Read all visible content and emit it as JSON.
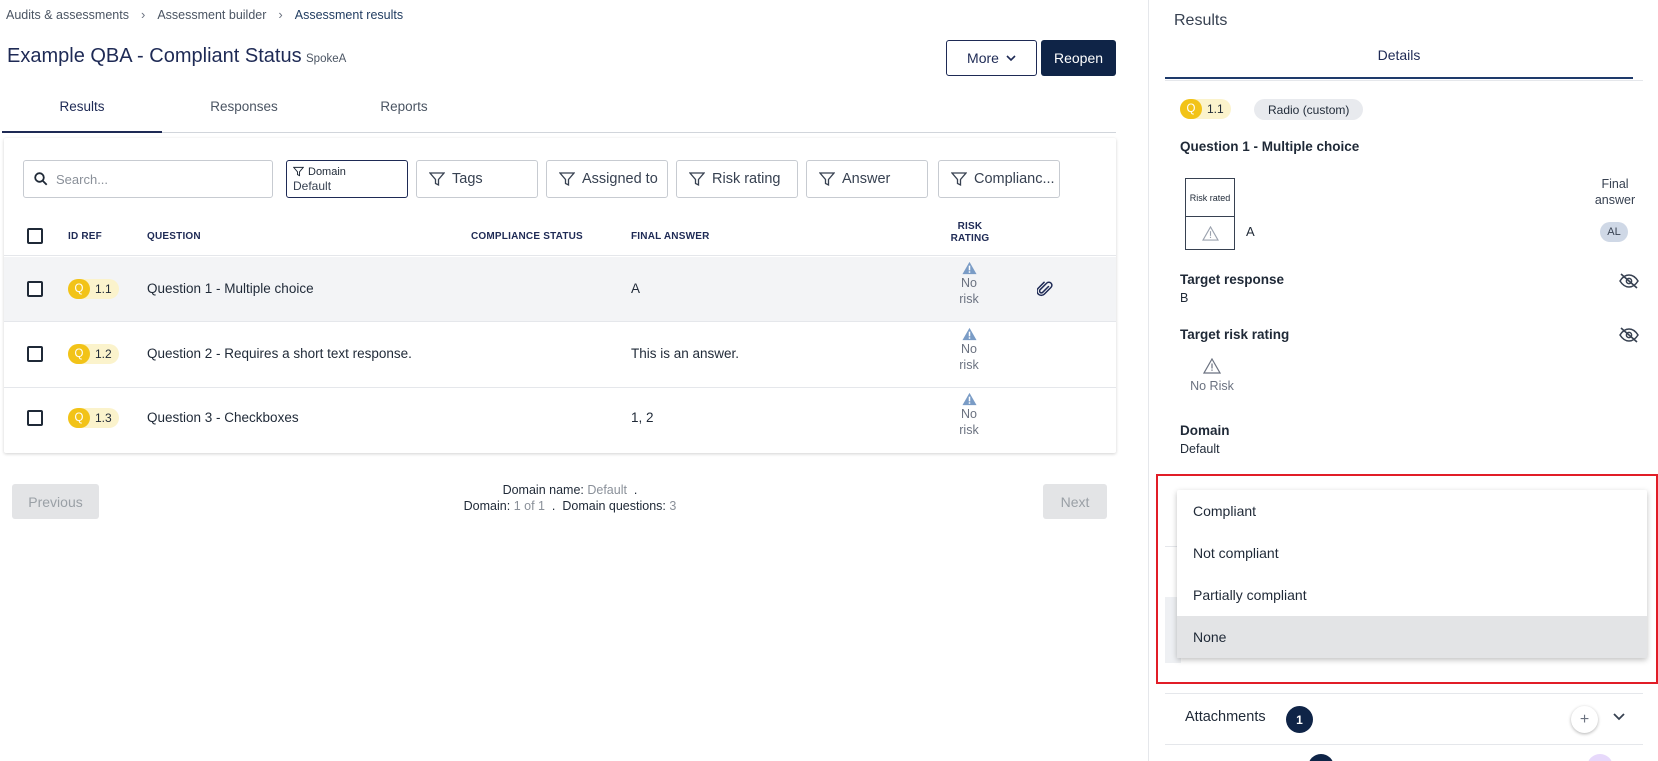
{
  "breadcrumb": [
    "Audits & assessments",
    "Assessment builder",
    "Assessment results"
  ],
  "header": {
    "title": "Example QBA - Compliant Status",
    "subtitle": "SpokeA",
    "more_label": "More",
    "reopen_label": "Reopen"
  },
  "tabs": [
    "Results",
    "Responses",
    "Reports"
  ],
  "search": {
    "placeholder": "Search..."
  },
  "filters": {
    "domain_label": "Domain",
    "domain_value": "Default",
    "tags": "Tags",
    "assigned": "Assigned to",
    "risk": "Risk rating",
    "answer": "Answer",
    "compliance": "Complianc..."
  },
  "table": {
    "headers": {
      "id_ref": "ID REF",
      "question": "QUESTION",
      "compliance": "COMPLIANCE STATUS",
      "final": "FINAL ANSWER",
      "risk_line1": "RISK",
      "risk_line2": "RATING"
    },
    "rows": [
      {
        "q": "Q",
        "ref": "1.1",
        "question": "Question 1 - Multiple choice",
        "answer": "A",
        "risk1": "No",
        "risk2": "risk"
      },
      {
        "q": "Q",
        "ref": "1.2",
        "question": "Question 2 - Requires a short text response.",
        "answer": "This is an answer.",
        "risk1": "No",
        "risk2": "risk"
      },
      {
        "q": "Q",
        "ref": "1.3",
        "question": "Question 3 - Checkboxes",
        "answer": "1, 2",
        "risk1": "No",
        "risk2": "risk"
      }
    ]
  },
  "pager": {
    "previous": "Previous",
    "next": "Next",
    "domain_name_label": "Domain name:",
    "domain_name": "Default",
    "domain_label": "Domain:",
    "domain_pos": "1 of 1",
    "questions_label": "Domain questions:",
    "questions": "3"
  },
  "panel": {
    "title": "Results",
    "tab": "Details",
    "q": "Q",
    "ref": "1.1",
    "type": "Radio (custom)",
    "question": "Question 1 - Multiple choice",
    "risk_rated": "Risk rated",
    "final_answer_value": "A",
    "final_answer_l1": "Final",
    "final_answer_l2": "answer",
    "avatar": "AL",
    "target_response_label": "Target response",
    "target_response": "B",
    "target_risk_label": "Target risk rating",
    "target_risk": "No Risk",
    "domain_label": "Domain",
    "domain": "Default",
    "dropdown": [
      "Compliant",
      "Not compliant",
      "Partially compliant",
      "None"
    ],
    "attachments_label": "Attachments",
    "attachments_count": "1"
  },
  "colors": {
    "navy": "#0f2447",
    "accent_yellow": "#f2c318",
    "highlight_red": "#e11d27",
    "risk_blue": "#7a9cc6"
  }
}
